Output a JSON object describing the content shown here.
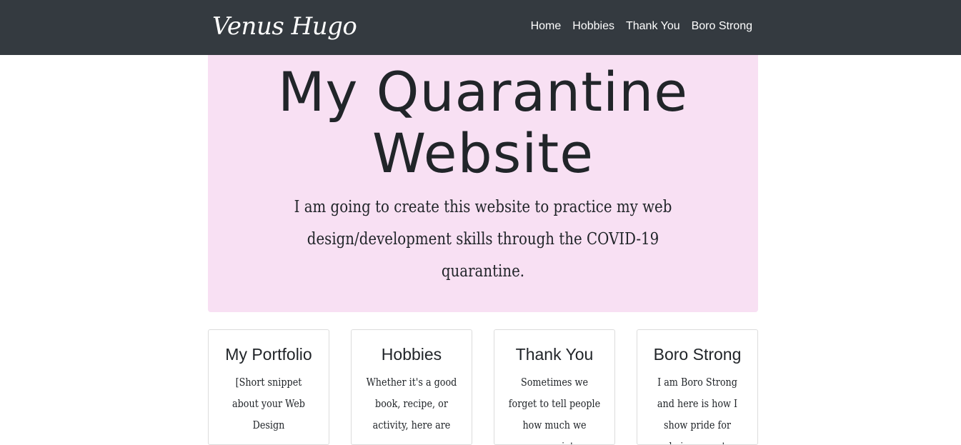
{
  "navbar": {
    "brand": "Venus Hugo",
    "links": [
      "Home",
      "Hobbies",
      "Thank You",
      "Boro Strong"
    ]
  },
  "hero": {
    "title_line1": "My Quarantine",
    "title_line2": "Website",
    "text": "I am going to create this website to practice my web design/development skills through the COVID-19 quarantine."
  },
  "cards": [
    {
      "title": "My Portfolio",
      "text": "[Short snippet about your Web Design"
    },
    {
      "title": "Hobbies",
      "text": "Whether it's a good book, recipe, or activity, here are"
    },
    {
      "title": "Thank You",
      "text": "Sometimes we forget to tell people how much we appreciate"
    },
    {
      "title": "Boro Strong",
      "text": "I am Boro Strong and here is how I show pride for being a part"
    }
  ],
  "colors": {
    "navbar_bg": "#343a40",
    "jumbotron_bg": "#f8e0f3",
    "text": "#212529"
  }
}
